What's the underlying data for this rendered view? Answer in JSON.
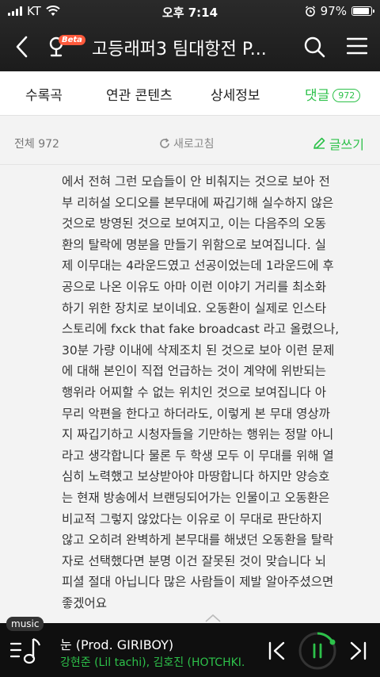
{
  "status_bar": {
    "carrier": "KT",
    "time": "오후 7:14",
    "battery": "97%",
    "battery_level": 0.97
  },
  "nav": {
    "title": "고등래퍼3 팀대항전 P...",
    "beta_badge": "Beta",
    "icons": [
      "back-arrow-icon",
      "app-logo-icon",
      "search-icon",
      "menu-icon"
    ]
  },
  "tabs": [
    {
      "label": "수록곡"
    },
    {
      "label": "연관 콘텐츠"
    },
    {
      "label": "상세정보"
    },
    {
      "label": "댓글",
      "count": "972",
      "active": true
    }
  ],
  "subbar": {
    "total": "전체 972",
    "refresh": "새로고침",
    "write": "글쓰기"
  },
  "comment": {
    "lines": [
      "에서 전혀 그런 모습들이 안 비춰지는 것으로 보아 전",
      "부 리허설 오디오를 본무대에 짜깁기해 실수하지 않은",
      "것으로 방영된 것으로 보여지고, 이는 다음주의 오동",
      "환의 탈락에 명분을 만들기 위함으로 보여집니다. 실",
      "제 이무대는 4라운드였고 선공이었는데 1라운드에 후",
      "공으로 나온 이유도 아마 이런 이야기 거리를 최소화",
      "하기 위한 장치로 보이네요. 오동환이 실제로 인스타",
      "스토리에 fxck that fake broadcast 라고 올렸으나,",
      "30분 가량 이내에 삭제조치 된 것으로 보아 이런 문제",
      "에 대해 본인이 직접 언급하는 것이 계약에 위반되는",
      "행위라 어찌할 수 없는 위치인 것으로 보여집니다 아",
      "무리 악편을 한다고 하더라도, 이렇게 본 무대 영상까",
      "지 짜깁기하고 시청자들을 기만하는 행위는 정말 아니",
      "라고 생각합니다 물론 두 학생 모두 이 무대를 위해 열",
      "심히 노력했고 보상받아야 마땅합니다 하지만 양승호",
      "는 현재 방송에서 브랜딩되어가는 인물이고 오동환은",
      "비교적 그렇지 않았다는 이유로 이 무대로 판단하지",
      "않고 오히려 완벽하게 본무대를 해냈던 오동환을 탈락",
      "자로 선택했다면 분명 이건 잘못된 것이 맞습니다 뇌",
      "피셜 절대 아닙니다 많은 사람들이 제발 알아주셨으면",
      "좋겠어요"
    ]
  },
  "player": {
    "badge": "music",
    "song_title": "눈 (Prod. GIRIBOY)",
    "artist": "강현준 (Lil tachi), 김호진 (HOTCHKI...",
    "accent": "#2dc14a"
  }
}
